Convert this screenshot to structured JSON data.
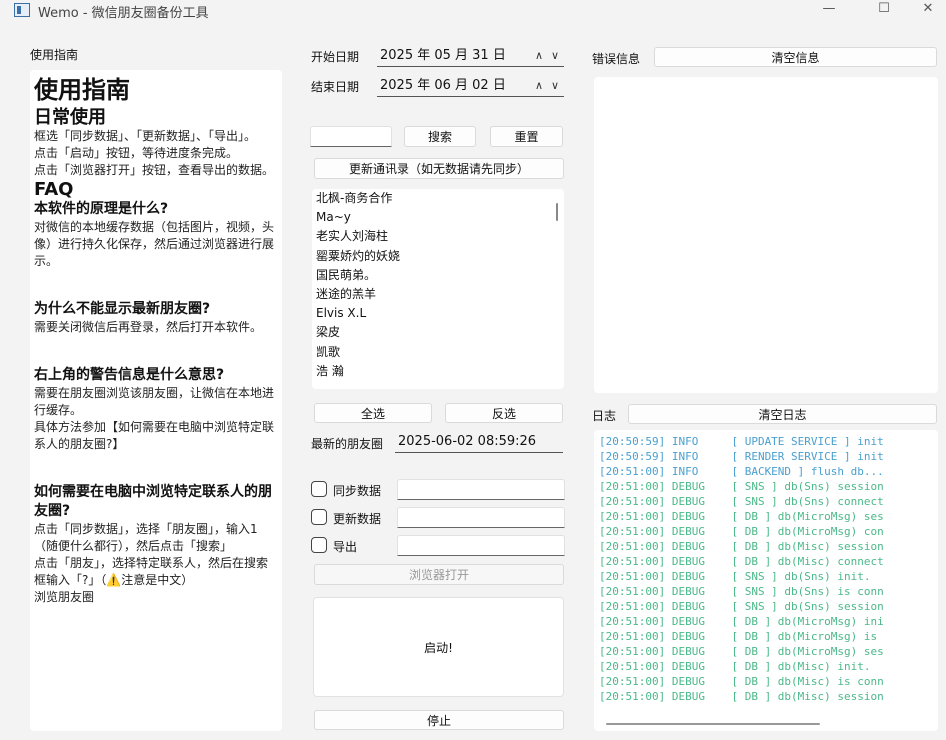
{
  "window": {
    "title": "Wemo - 微信朋友圈备份工具",
    "minimize": "—",
    "maximize": "☐",
    "close": "✕"
  },
  "guide": {
    "section_label": "使用指南",
    "title": "使用指南",
    "daily_heading": "日常使用",
    "daily_lines": [
      "框选「同步数据」、「更新数据」、「导出」。",
      "点击「启动」按钮，等待进度条完成。",
      "点击「浏览器打开」按钮，查看导出的数据。"
    ],
    "faq_heading": "FAQ",
    "faq": [
      {
        "q": "本软件的原理是什么?",
        "a": [
          "对微信的本地缓存数据（包括图片，视频，头像）进行持久化保存，然后通过浏览器进行展示。"
        ]
      },
      {
        "q": "为什么不能显示最新朋友圈?",
        "a": [
          "需要关闭微信后再登录，然后打开本软件。"
        ]
      },
      {
        "q": "右上角的警告信息是什么意思?",
        "a": [
          "需要在朋友圈浏览该朋友圈，让微信在本地进行缓存。",
          "具体方法参加【如何需要在电脑中浏览特定联系人的朋友圈?】"
        ]
      },
      {
        "q": "如何需要在电脑中浏览特定联系人的朋友圈?",
        "a": [
          "点击「同步数据」，选择「朋友圈」，输入1 （随便什么都行），然后点击「搜索」",
          "点击「朋友」，选择特定联系人，然后在搜索框输入「?」（⚠️注意是中文）",
          "浏览朋友圈"
        ]
      }
    ]
  },
  "dates": {
    "start_label": "开始日期",
    "start_value": "2025 年 05 月 31 日",
    "end_label": "结束日期",
    "end_value": "2025 年 06 月 02 日",
    "spin_up": "∧",
    "spin_down": "∨"
  },
  "search": {
    "input_value": "",
    "search_button": "搜索",
    "reset_button": "重置",
    "update_contacts_button": "更新通讯录（如无数据请先同步）"
  },
  "contacts": [
    "北枫-商务合作",
    "Ma~y",
    "老实人刘海柱",
    "罂粟娇灼的妖娆",
    "国民萌弟。",
    "迷途的羔羊",
    "Elvis X.L",
    "梁皮",
    "凯歌",
    "浩 瀚"
  ],
  "selection": {
    "select_all": "全选",
    "invert": "反选"
  },
  "latest": {
    "label": "最新的朋友圈",
    "value": "2025-06-02 08:59:26"
  },
  "options": [
    {
      "label": "同步数据",
      "checked": false
    },
    {
      "label": "更新数据",
      "checked": false
    },
    {
      "label": "导出",
      "checked": false
    }
  ],
  "actions": {
    "open_browser": "浏览器打开",
    "start": "启动!",
    "stop": "停止"
  },
  "errors": {
    "label": "错误信息",
    "clear_button": "清空信息"
  },
  "log": {
    "label": "日志",
    "clear_button": "清空日志",
    "lines": [
      {
        "level": "info",
        "text": "[20:50:59] INFO     [ UPDATE SERVICE ] init"
      },
      {
        "level": "info",
        "text": "[20:50:59] INFO     [ RENDER SERVICE ] init"
      },
      {
        "level": "info",
        "text": "[20:51:00] INFO     [ BACKEND ] flush db..."
      },
      {
        "level": "debug",
        "text": "[20:51:00] DEBUG    [ SNS ] db(Sns) session"
      },
      {
        "level": "debug",
        "text": "[20:51:00] DEBUG    [ SNS ] db(Sns) connect"
      },
      {
        "level": "debug",
        "text": "[20:51:00] DEBUG    [ DB ] db(MicroMsg) ses"
      },
      {
        "level": "debug",
        "text": "[20:51:00] DEBUG    [ DB ] db(MicroMsg) con"
      },
      {
        "level": "debug",
        "text": "[20:51:00] DEBUG    [ DB ] db(Misc) session"
      },
      {
        "level": "debug",
        "text": "[20:51:00] DEBUG    [ DB ] db(Misc) connect"
      },
      {
        "level": "debug",
        "text": "[20:51:00] DEBUG    [ SNS ] db(Sns) init."
      },
      {
        "level": "debug",
        "text": "[20:51:00] DEBUG    [ SNS ] db(Sns) is conn"
      },
      {
        "level": "debug",
        "text": "[20:51:00] DEBUG    [ SNS ] db(Sns) session"
      },
      {
        "level": "debug",
        "text": "[20:51:00] DEBUG    [ DB ] db(MicroMsg) ini"
      },
      {
        "level": "debug",
        "text": "[20:51:00] DEBUG    [ DB ] db(MicroMsg) is "
      },
      {
        "level": "debug",
        "text": "[20:51:00] DEBUG    [ DB ] db(MicroMsg) ses"
      },
      {
        "level": "debug",
        "text": "[20:51:00] DEBUG    [ DB ] db(Misc) init."
      },
      {
        "level": "debug",
        "text": "[20:51:00] DEBUG    [ DB ] db(Misc) is conn"
      },
      {
        "level": "debug",
        "text": "[20:51:00] DEBUG    [ DB ] db(Misc) session"
      }
    ]
  },
  "colors": {
    "info": "#4aa0cf",
    "debug": "#4bb889",
    "background": "#f3f3f3"
  }
}
